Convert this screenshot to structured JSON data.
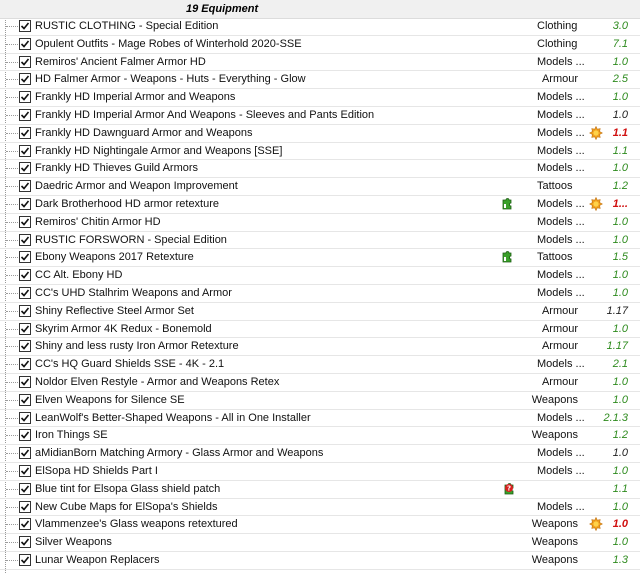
{
  "group": {
    "title": "19 Equipment"
  },
  "colors": {
    "green": "#2e8b1e",
    "red": "#d01010",
    "black": "#222222"
  },
  "rows": [
    {
      "name": "RUSTIC CLOTHING - Special Edition",
      "category": "Clothing",
      "version": "3.0",
      "version_color": "green",
      "flag": "",
      "warn": false
    },
    {
      "name": "Opulent Outfits - Mage Robes of Winterhold 2020-SSE",
      "category": "Clothing",
      "version": "7.1",
      "version_color": "green",
      "flag": "",
      "warn": false
    },
    {
      "name": "Remiros' Ancient Falmer Armor HD",
      "category": "Models ...",
      "version": "1.0",
      "version_color": "green",
      "flag": "",
      "warn": false
    },
    {
      "name": "HD Falmer Armor - Weapons - Huts - Everything - Glow",
      "category": "Armour",
      "version": "2.5",
      "version_color": "green",
      "flag": "",
      "warn": false
    },
    {
      "name": "Frankly HD Imperial Armor and Weapons",
      "category": "Models ...",
      "version": "1.0",
      "version_color": "green",
      "flag": "",
      "warn": false
    },
    {
      "name": "Frankly HD Imperial Armor And Weapons - Sleeves and Pants Edition",
      "category": "Models ...",
      "version": "1.0",
      "version_color": "black",
      "flag": "",
      "warn": false
    },
    {
      "name": "Frankly HD Dawnguard Armor and Weapons",
      "category": "Models ...",
      "version": "1.1",
      "version_color": "red",
      "flag": "",
      "warn": true
    },
    {
      "name": "Frankly HD Nightingale Armor and Weapons [SSE]",
      "category": "Models ...",
      "version": "1.1",
      "version_color": "green",
      "flag": "",
      "warn": false
    },
    {
      "name": "Frankly HD Thieves Guild Armors",
      "category": "Models ...",
      "version": "1.0",
      "version_color": "green",
      "flag": "",
      "warn": false
    },
    {
      "name": "Daedric Armor and Weapon Improvement",
      "category": "Tattoos",
      "version": "1.2",
      "version_color": "green",
      "flag": "",
      "warn": false
    },
    {
      "name": "Dark Brotherhood HD armor retexture",
      "category": "Models ...",
      "version": "1...",
      "version_color": "red",
      "flag": "green-puzzle-icon",
      "warn": true
    },
    {
      "name": "Remiros' Chitin Armor HD",
      "category": "Models ...",
      "version": "1.0",
      "version_color": "green",
      "flag": "",
      "warn": false
    },
    {
      "name": "RUSTIC FORSWORN - Special Edition",
      "category": "Models ...",
      "version": "1.0",
      "version_color": "green",
      "flag": "",
      "warn": false
    },
    {
      "name": "Ebony Weapons 2017 Retexture",
      "category": "Tattoos",
      "version": "1.5",
      "version_color": "green",
      "flag": "green-puzzle-icon",
      "warn": false
    },
    {
      "name": "CC Alt. Ebony HD",
      "category": "Models ...",
      "version": "1.0",
      "version_color": "green",
      "flag": "",
      "warn": false
    },
    {
      "name": "CC's UHD Stalhrim Weapons and Armor",
      "category": "Models ...",
      "version": "1.0",
      "version_color": "green",
      "flag": "",
      "warn": false
    },
    {
      "name": "Shiny Reflective Steel Armor Set",
      "category": "Armour",
      "version": "1.17",
      "version_color": "black",
      "flag": "",
      "warn": false
    },
    {
      "name": "Skyrim Armor 4K Redux - Bonemold",
      "category": "Armour",
      "version": "1.0",
      "version_color": "green",
      "flag": "",
      "warn": false
    },
    {
      "name": "Shiny and less rusty Iron Armor Retexture",
      "category": "Armour",
      "version": "1.17",
      "version_color": "green",
      "flag": "",
      "warn": false
    },
    {
      "name": "CC's HQ Guard Shields SSE - 4K - 2.1",
      "category": "Models ...",
      "version": "2.1",
      "version_color": "green",
      "flag": "",
      "warn": false
    },
    {
      "name": "Noldor Elven Restyle - Armor and Weapons Retex",
      "category": "Armour",
      "version": "1.0",
      "version_color": "green",
      "flag": "",
      "warn": false
    },
    {
      "name": "Elven Weapons for Silence SE",
      "category": "Weapons",
      "version": "1.0",
      "version_color": "green",
      "flag": "",
      "warn": false
    },
    {
      "name": "LeanWolf's Better-Shaped Weapons - All in One Installer",
      "category": "Models ...",
      "version": "2.1.3",
      "version_color": "green",
      "flag": "",
      "warn": false
    },
    {
      "name": "Iron Things SE",
      "category": "Weapons",
      "version": "1.2",
      "version_color": "green",
      "flag": "",
      "warn": false
    },
    {
      "name": "aMidianBorn Matching Armory - Glass Armor and Weapons",
      "category": "Models ...",
      "version": "1.0",
      "version_color": "black",
      "flag": "",
      "warn": false
    },
    {
      "name": "ElSopa HD Shields Part I",
      "category": "Models ...",
      "version": "1.0",
      "version_color": "green",
      "flag": "",
      "warn": false
    },
    {
      "name": "Blue tint for Elsopa Glass shield patch",
      "category": "",
      "version": "1.1",
      "version_color": "green",
      "flag": "red-puzzle-question-icon",
      "warn": false
    },
    {
      "name": "New Cube Maps for ElSopa's Shields",
      "category": "Models ...",
      "version": "1.0",
      "version_color": "green",
      "flag": "",
      "warn": false
    },
    {
      "name": "Vlammenzee's Glass weapons retextured",
      "category": "Weapons",
      "version": "1.0",
      "version_color": "red",
      "flag": "",
      "warn": true
    },
    {
      "name": "Silver Weapons",
      "category": "Weapons",
      "version": "1.0",
      "version_color": "green",
      "flag": "",
      "warn": false
    },
    {
      "name": "Lunar Weapon Replacers",
      "category": "Weapons",
      "version": "1.3",
      "version_color": "green",
      "flag": "",
      "warn": false
    }
  ]
}
